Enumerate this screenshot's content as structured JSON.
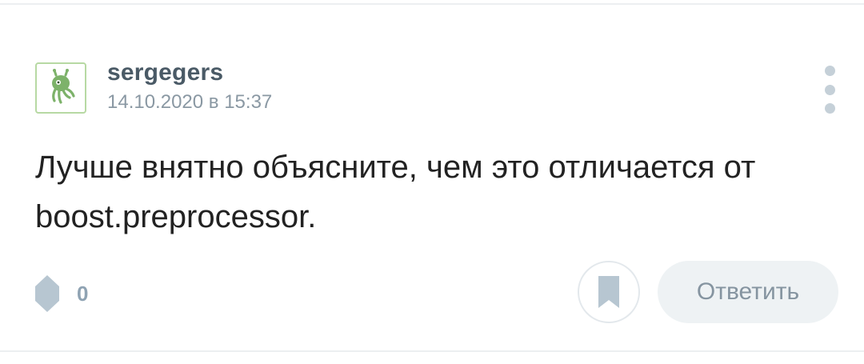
{
  "comment": {
    "author": {
      "username": "sergegers",
      "avatar_icon": "octopus-alien-icon"
    },
    "timestamp": "14.10.2020 в 15:37",
    "text": "Лучше внятно объясните, чем это отличается от boost.preprocessor."
  },
  "actions": {
    "menu_icon": "vertical-dots-icon",
    "rating_icon": "rating-diamond-icon",
    "rating_count": "0",
    "bookmark_icon": "bookmark-icon",
    "reply_label": "Ответить"
  },
  "colors": {
    "username": "#4a5a66",
    "timestamp": "#8a98a3",
    "text": "#222222",
    "icon_muted": "#b7c6d1",
    "avatar_green": "#7db26a",
    "reply_bg": "#eef2f4"
  }
}
